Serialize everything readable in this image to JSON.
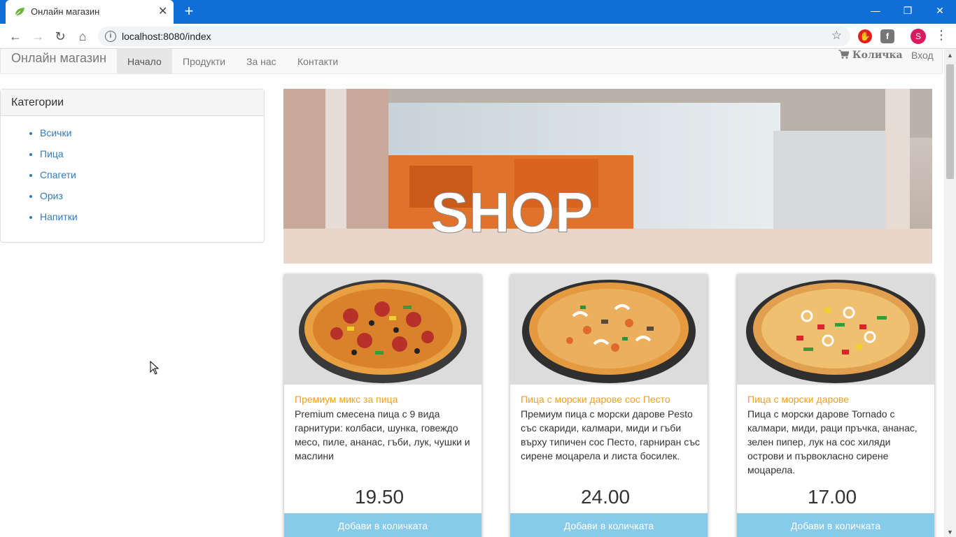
{
  "browser": {
    "tab_title": "Онлайн магазин",
    "url": "localhost:8080/index",
    "profile_initial": "S"
  },
  "navbar": {
    "brand": "Онлайн магазин",
    "items": [
      {
        "label": "Начало",
        "active": true
      },
      {
        "label": "Продукти",
        "active": false
      },
      {
        "label": "За нас",
        "active": false
      },
      {
        "label": "Контакти",
        "active": false
      }
    ],
    "cart_label": "Количка",
    "login_label": "Вход"
  },
  "categories": {
    "heading": "Категории",
    "items": [
      "Всички",
      "Пица",
      "Спагети",
      "Ориз",
      "Напитки"
    ]
  },
  "banner": {
    "text": "SHOP"
  },
  "products": [
    {
      "title": "Премиум микс за пица",
      "description": "Premium смесена пица с 9 вида гарнитури: колбаси, шунка, говеждо месо, пиле, ананас, гъби, лук, чушки и маслини",
      "price": "19.50",
      "button": "Добави в количката"
    },
    {
      "title": "Пица с морски дарове сос Песто",
      "description": "Премиум пица с морски дарове Pesto със скариди, калмари, миди и гъби върху типичен сос Песто, гарниран със сирене моцарела и листа босилек.",
      "price": "24.00",
      "button": "Добави в количката"
    },
    {
      "title": "Пица с морски дарове",
      "description": "Пица с морски дарове Tornado с калмари, миди, раци пръчка, ананас, зелен пипер, лук на сос хиляди острови и първокласно сирене моцарела.",
      "price": "17.00",
      "button": "Добави в количката"
    }
  ],
  "colors": {
    "chrome_blue": "#0f6fd6",
    "link_blue": "#337ab7",
    "product_title_orange": "#f0a020",
    "button_blue": "#87cbea"
  }
}
